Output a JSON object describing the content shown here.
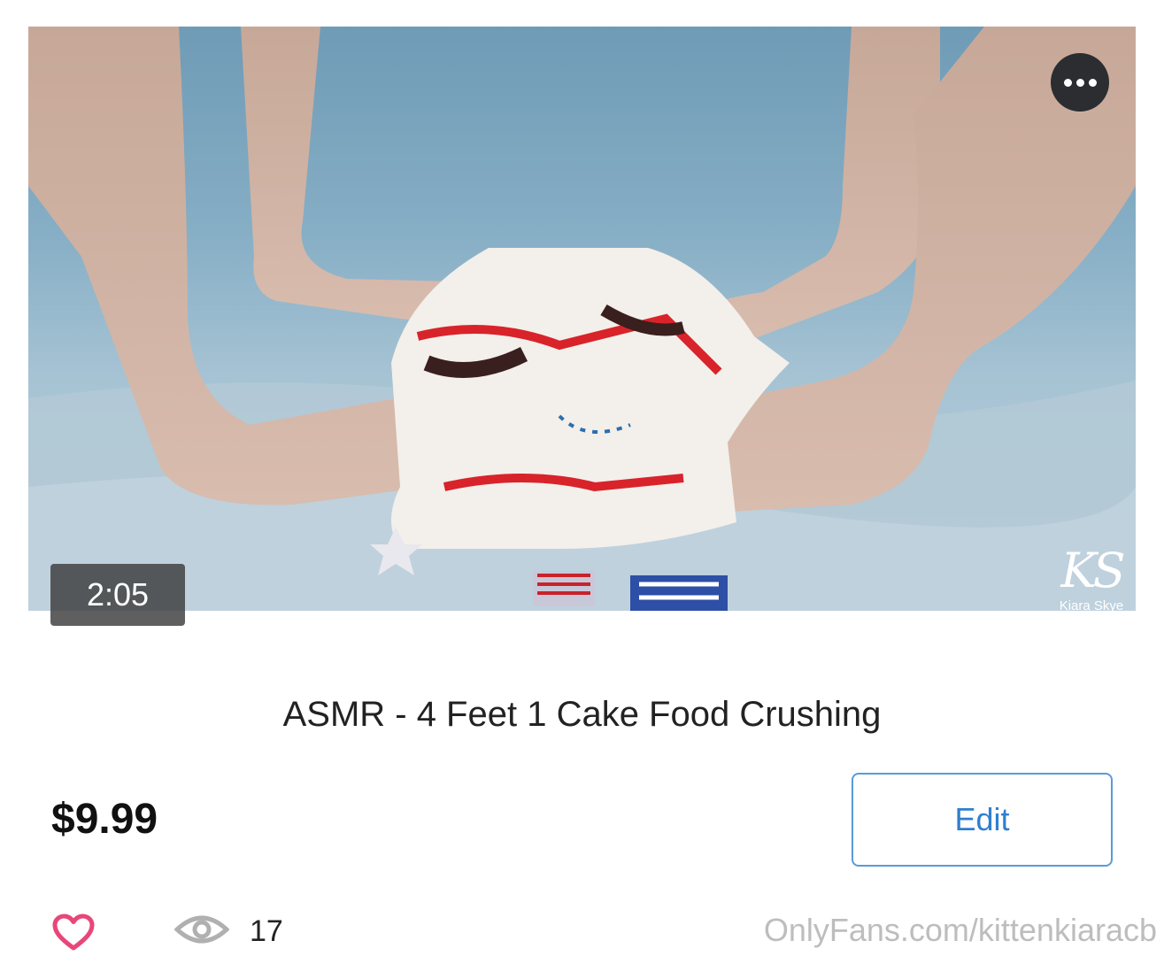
{
  "post": {
    "media": {
      "duration": "2:05",
      "watermark_monogram": "KS",
      "watermark_name": "Kiara Skye",
      "more_icon": "more-horizontal-icon"
    },
    "title": "ASMR - 4 Feet 1 Cake Food Crushing",
    "price": "$9.99",
    "edit_label": "Edit",
    "like_icon": "heart-icon",
    "views_icon": "eye-icon",
    "views_count": "17",
    "source_url": "OnlyFans.com/kittenkiaracb"
  },
  "colors": {
    "accent_blue": "#2f7fd0",
    "heart_pink": "#e8477a",
    "muted_gray": "#bdbdbd"
  }
}
